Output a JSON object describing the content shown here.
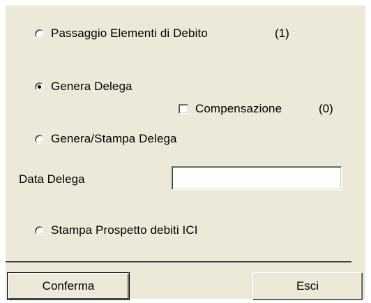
{
  "options": {
    "passaggio": {
      "label": "Passaggio Elementi di Debito",
      "count": "(1)",
      "checked": false
    },
    "genera": {
      "label": "Genera Delega",
      "checked": true
    },
    "compensazione": {
      "label": "Compensazione",
      "count": "(0)",
      "checked": false
    },
    "genera_stampa": {
      "label": "Genera/Stampa Delega",
      "checked": false
    },
    "stampa_prospetto": {
      "label": "Stampa Prospetto debiti ICI",
      "checked": false
    }
  },
  "data_delega": {
    "label": "Data Delega",
    "value": ""
  },
  "buttons": {
    "conferma": "Conferma",
    "esci": "Esci"
  }
}
